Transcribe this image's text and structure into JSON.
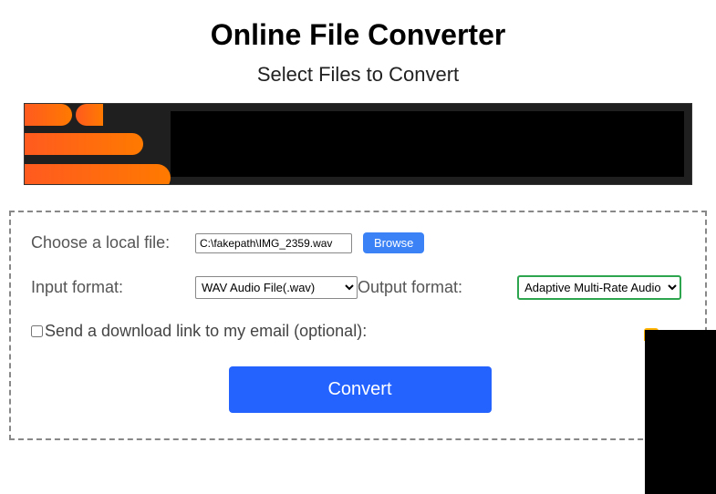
{
  "header": {
    "title": "Online File Converter",
    "subtitle": "Select Files to Convert"
  },
  "form": {
    "choose_file_label": "Choose a local file:",
    "file_value": "C:\\fakepath\\IMG_2359.wav",
    "browse_label": "Browse",
    "input_format_label": "Input format:",
    "input_format_value": "WAV Audio File(.wav)",
    "output_format_label": "Output format:",
    "output_format_value": "Adaptive Multi-Rate Audio File(.amr)",
    "email_label": "Send a download link to my email (optional):",
    "convert_label": "Convert"
  }
}
